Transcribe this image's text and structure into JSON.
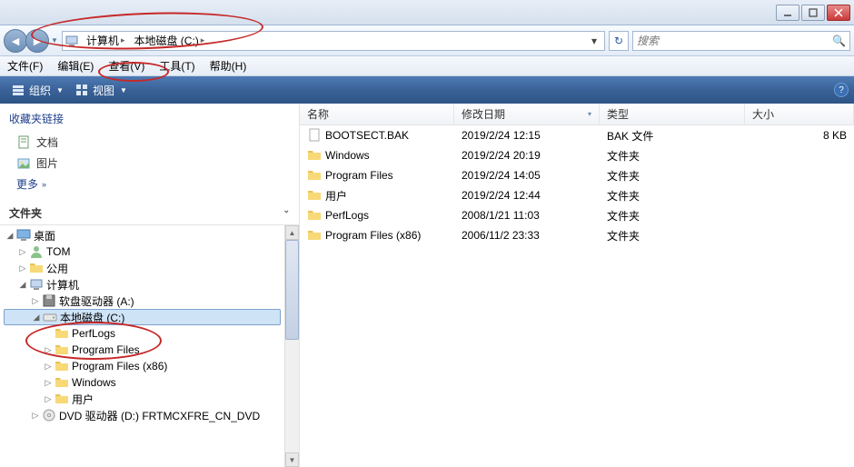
{
  "win_controls": {
    "min": "minimize",
    "max": "maximize",
    "close": "close"
  },
  "breadcrumb": {
    "segments": [
      "计算机",
      "本地磁盘 (C:)"
    ],
    "dropdown_hint": "▾"
  },
  "search": {
    "placeholder": "搜索"
  },
  "menubar": [
    {
      "label": "文件(F)"
    },
    {
      "label": "编辑(E)"
    },
    {
      "label": "查看(V)"
    },
    {
      "label": "工具(T)"
    },
    {
      "label": "帮助(H)"
    }
  ],
  "toolbar": {
    "organize": "组织",
    "views": "视图"
  },
  "sidebar": {
    "fav_title": "收藏夹链接",
    "fav_items": [
      {
        "icon": "doc",
        "label": "文档"
      },
      {
        "icon": "pic",
        "label": "图片"
      }
    ],
    "more": "更多",
    "folders_title": "文件夹"
  },
  "tree": [
    {
      "indent": 0,
      "tw": "◢",
      "icon": "desktop",
      "label": "桌面"
    },
    {
      "indent": 1,
      "tw": "▷",
      "icon": "user",
      "label": "TOM"
    },
    {
      "indent": 1,
      "tw": "▷",
      "icon": "folder",
      "label": "公用"
    },
    {
      "indent": 1,
      "tw": "◢",
      "icon": "computer",
      "label": "计算机"
    },
    {
      "indent": 2,
      "tw": "▷",
      "icon": "floppy",
      "label": "软盘驱动器 (A:)"
    },
    {
      "indent": 2,
      "tw": "◢",
      "icon": "drive",
      "label": "本地磁盘 (C:)",
      "selected": true
    },
    {
      "indent": 3,
      "tw": "",
      "icon": "folder",
      "label": "PerfLogs"
    },
    {
      "indent": 3,
      "tw": "▷",
      "icon": "folder",
      "label": "Program Files"
    },
    {
      "indent": 3,
      "tw": "▷",
      "icon": "folder",
      "label": "Program Files (x86)"
    },
    {
      "indent": 3,
      "tw": "▷",
      "icon": "folder",
      "label": "Windows"
    },
    {
      "indent": 3,
      "tw": "▷",
      "icon": "folder",
      "label": "用户"
    },
    {
      "indent": 2,
      "tw": "▷",
      "icon": "dvd",
      "label": "DVD 驱动器 (D:) FRTMCXFRE_CN_DVD"
    }
  ],
  "columns": {
    "name": "名称",
    "date": "修改日期",
    "type": "类型",
    "size": "大小"
  },
  "rows": [
    {
      "icon": "file",
      "name": "BOOTSECT.BAK",
      "date": "2019/2/24 12:15",
      "type": "BAK 文件",
      "size": "8 KB"
    },
    {
      "icon": "folder",
      "name": "Windows",
      "date": "2019/2/24 20:19",
      "type": "文件夹",
      "size": ""
    },
    {
      "icon": "folder",
      "name": "Program Files",
      "date": "2019/2/24 14:05",
      "type": "文件夹",
      "size": ""
    },
    {
      "icon": "folder",
      "name": "用户",
      "date": "2019/2/24 12:44",
      "type": "文件夹",
      "size": ""
    },
    {
      "icon": "folder",
      "name": "PerfLogs",
      "date": "2008/1/21 11:03",
      "type": "文件夹",
      "size": ""
    },
    {
      "icon": "folder",
      "name": "Program Files (x86)",
      "date": "2006/11/2 23:33",
      "type": "文件夹",
      "size": ""
    }
  ]
}
